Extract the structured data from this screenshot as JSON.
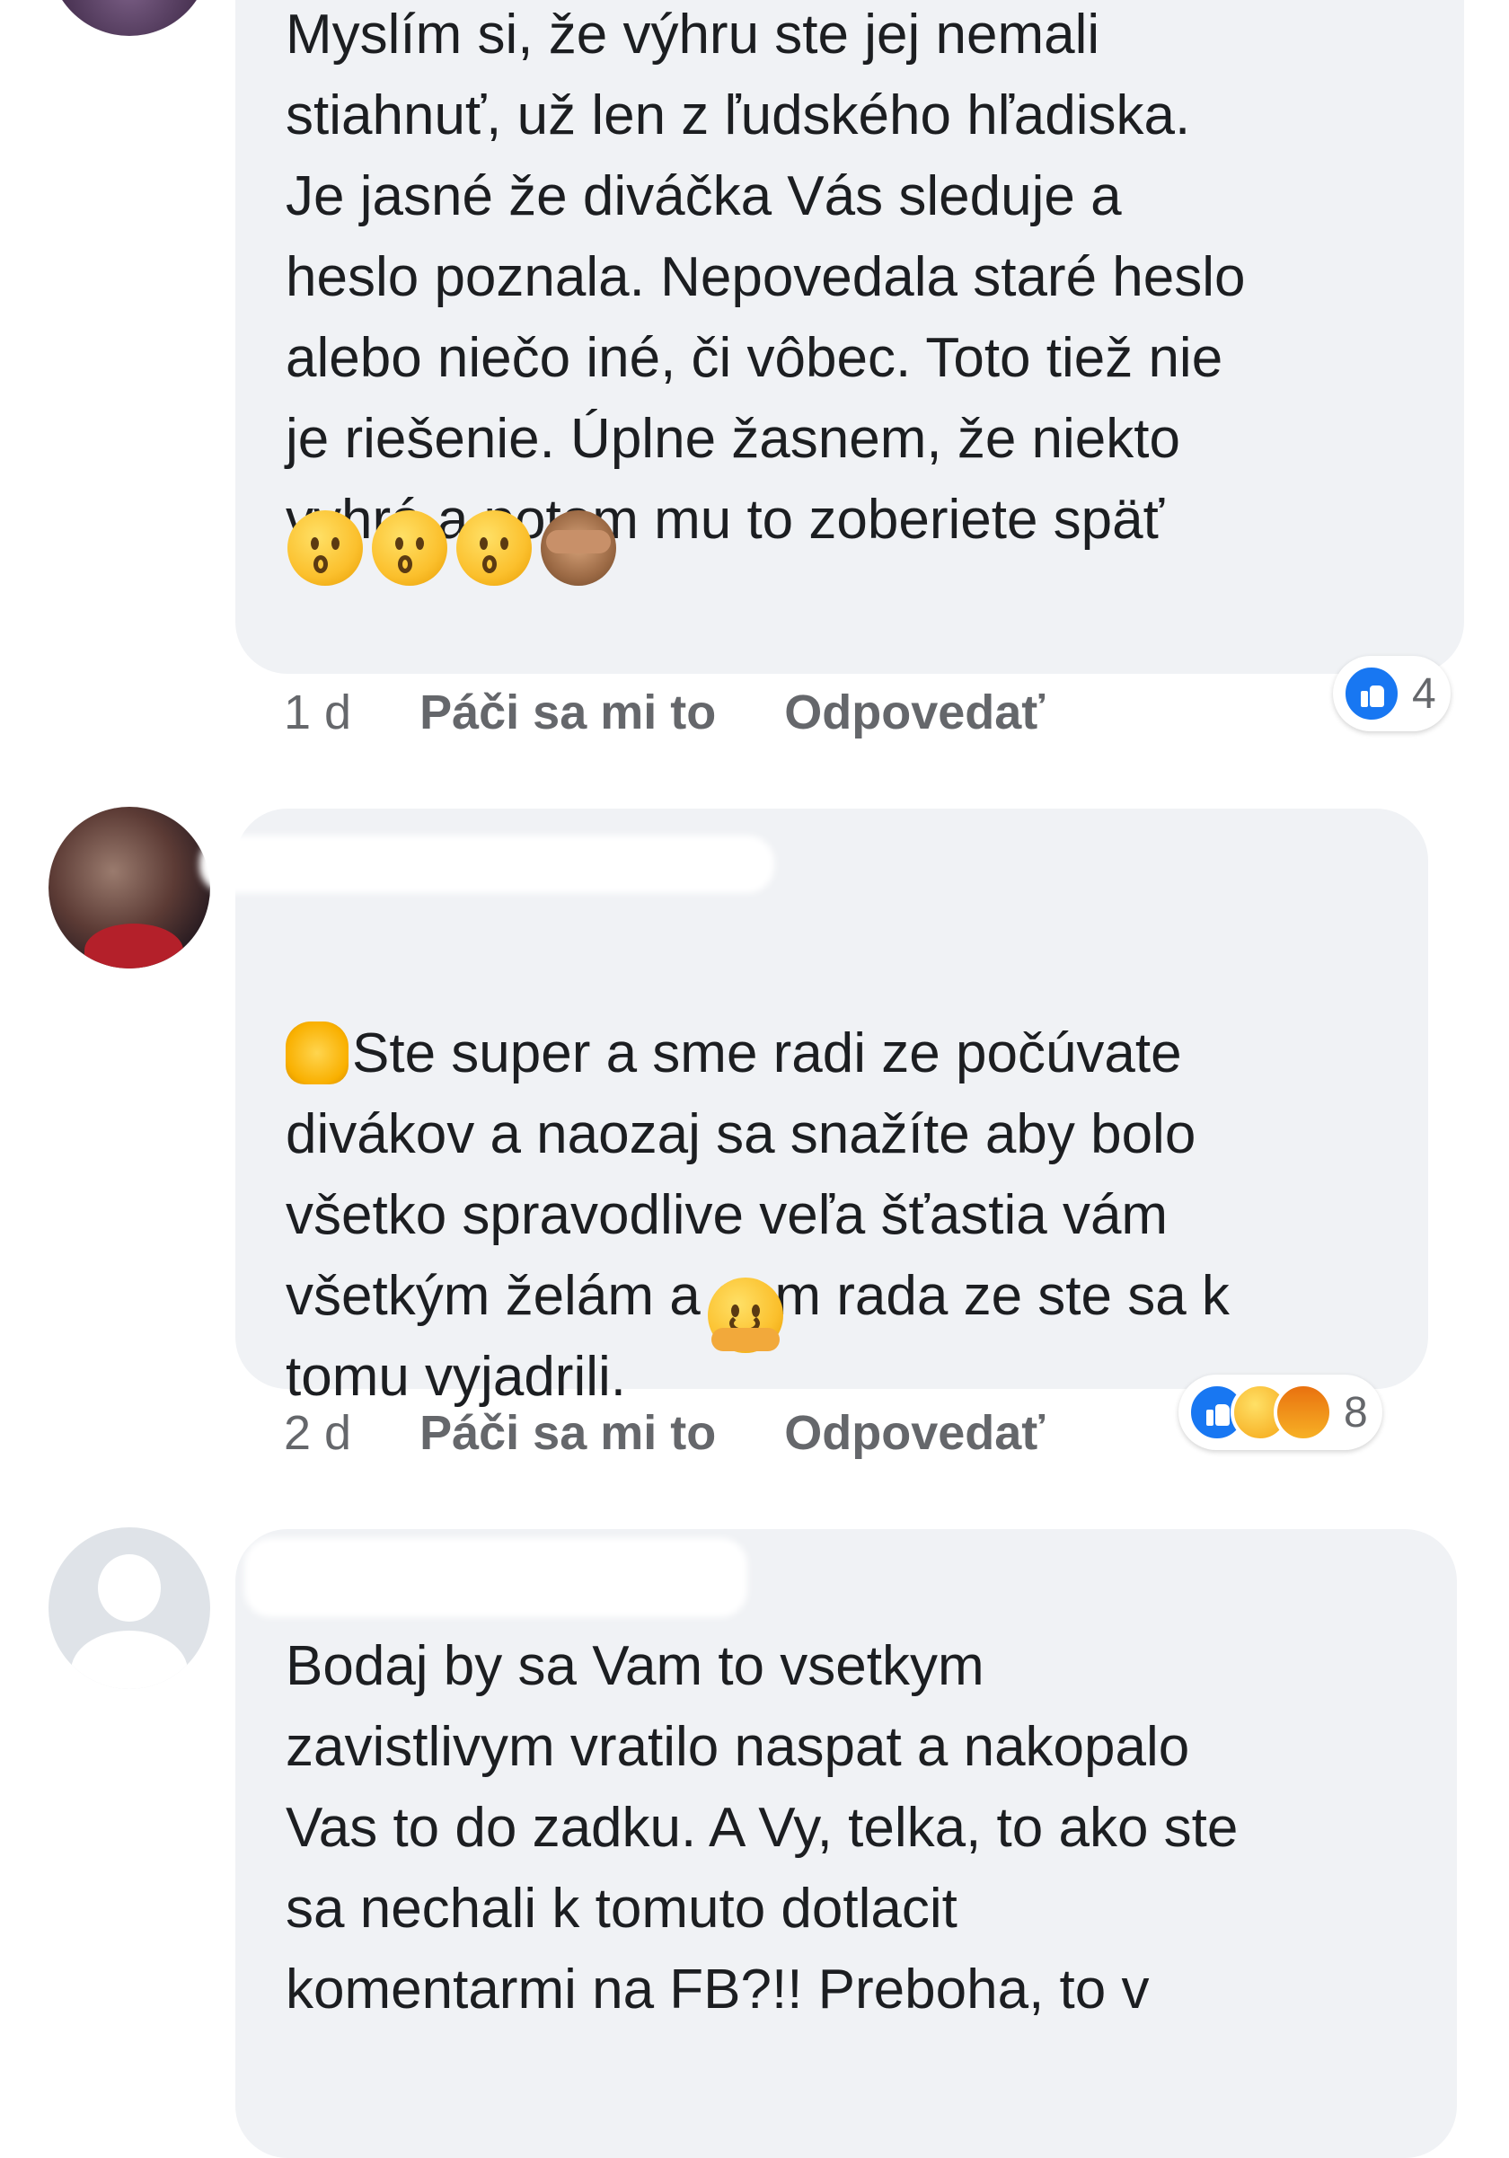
{
  "comments": [
    {
      "text": "Myslím si, že výhru ste jej nemali\nstiahnuť, už len z ľudského hľadiska.\nJe jasné že diváčka Vás sleduje a\nheslo poznala. Nepovedala staré heslo\nalebo niečo iné, či vôbec. Toto tiež nie\nje riešenie. Úplne žasnem, že niekto\nvyhrá a potom mu to zoberiete späť",
      "emojis": [
        "hushed-face-emoji",
        "hushed-face-emoji",
        "hushed-face-emoji",
        "see-no-evil-monkey-emoji"
      ],
      "time": "1 d",
      "like_label": "Páči sa mi to",
      "reply_label": "Odpovedať",
      "reaction_count": "4"
    },
    {
      "text": "Ste super a sme radi ze počúvate\ndivákov a naozaj sa snažíte aby bolo\nvšetko spravodlive veľa šťastia vám\nvšetkým želám a som rada ze ste sa k\ntomu vyjadrili.",
      "time": "2 d",
      "like_label": "Páči sa mi to",
      "reply_label": "Odpovedať",
      "reaction_count": "8"
    },
    {
      "text": "Bodaj by sa Vam to vsetkym\nzavistlivym vratilo naspat a nakopalo\nVas to do zadku. A Vy, telka, to ako ste\nsa nechali k tomuto dotlacit\nkomentarmi na FB?!! Preboha, to v"
    }
  ]
}
